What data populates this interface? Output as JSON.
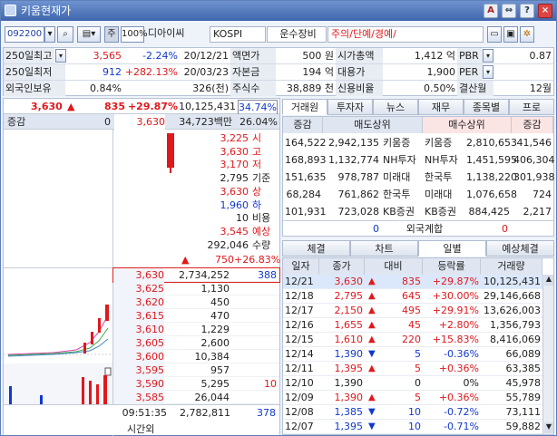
{
  "window": {
    "title": "키움현재가"
  },
  "toolbar": {
    "code": "092200",
    "name": "디아이씨",
    "market": "KOSPI",
    "sector": "운수장비",
    "warn": "주의/단예/경예/",
    "unit_label": "주",
    "pct_label": "100%"
  },
  "info": {
    "rows": [
      {
        "l1": "250일최고",
        "v1": "3,565",
        "p1": "-2.24%",
        "d1": "20/12/21",
        "l2": "액면가",
        "v2": "500 원",
        "l3": "시가총액",
        "v3": "1,412 억",
        "l4": "PBR",
        "v4": "0.87"
      },
      {
        "l1": "250일최저",
        "v1": "912",
        "p1": "+282.13%",
        "d1": "20/03/23",
        "l2": "자본금",
        "v2": "194 억",
        "l3": "대용가",
        "v3": "1,900",
        "l4": "PER",
        "v4": ""
      },
      {
        "l1": "외국인보유",
        "v1": "0.84%",
        "p1": "",
        "d1": "326(천)",
        "l2": "주식수",
        "v2": "38,889 천",
        "l3": "신용비율",
        "v3": "0.50%",
        "l4": "결산월",
        "v4": "12월"
      }
    ]
  },
  "quote": {
    "price": "3,630",
    "change": "835",
    "rate": "+29.87%",
    "volume": "10,125,431",
    "vol_rate": "34.74%",
    "zg_label": "증감",
    "zg_val": "0",
    "row2_price": "3,630",
    "row2_amt": "34,723백만",
    "row2_rate": "26.04%"
  },
  "summary": [
    {
      "v": "3,225",
      "k": "시",
      "c": "red"
    },
    {
      "v": "3,630",
      "k": "고",
      "c": "red"
    },
    {
      "v": "3,170",
      "k": "저",
      "c": "red"
    },
    {
      "v": "2,795",
      "k": "기준",
      "c": ""
    },
    {
      "v": "3,630",
      "k": "상",
      "c": "red"
    },
    {
      "v": "1,960",
      "k": "하",
      "c": "blue"
    },
    {
      "v": "10",
      "k": "비용",
      "c": ""
    },
    {
      "v": "3,545",
      "k": "예상",
      "c": "red"
    },
    {
      "v": "292,046",
      "k": "수량",
      "c": ""
    }
  ],
  "expected": {
    "chg": "750",
    "rate": "+26.83%"
  },
  "bids": [
    {
      "price": "3,630",
      "qty": "2,734,252",
      "extra": "388"
    },
    {
      "price": "3,625",
      "qty": "1,130",
      "extra": ""
    },
    {
      "price": "3,620",
      "qty": "450",
      "extra": ""
    },
    {
      "price": "3,615",
      "qty": "470",
      "extra": ""
    },
    {
      "price": "3,610",
      "qty": "1,229",
      "extra": ""
    },
    {
      "price": "3,605",
      "qty": "2,600",
      "extra": ""
    },
    {
      "price": "3,600",
      "qty": "10,384",
      "extra": ""
    },
    {
      "price": "3,595",
      "qty": "957",
      "extra": ""
    },
    {
      "price": "3,590",
      "qty": "5,295",
      "extra": "10"
    },
    {
      "price": "3,585",
      "qty": "26,044",
      "extra": ""
    }
  ],
  "bottom": {
    "time": "09:51:35",
    "total": "2,782,811",
    "extra": "378",
    "afterhours": "시간외"
  },
  "rtabs": [
    "거래원",
    "투자자",
    "뉴스",
    "재무",
    "종목별",
    "프로"
  ],
  "broker": {
    "headers": [
      "증감",
      "매도상위",
      "매수상위",
      "증감"
    ],
    "rows": [
      [
        "164,522",
        "2,942,135",
        "키움증",
        "키움증",
        "2,810,653",
        "41,546"
      ],
      [
        "168,893",
        "1,132,774",
        "NH투자",
        "NH투자",
        "1,451,595",
        "406,304"
      ],
      [
        "151,635",
        "978,787",
        "미래대",
        "한국투",
        "1,138,220",
        "301,938"
      ],
      [
        "68,284",
        "761,862",
        "한국투",
        "미래대",
        "1,076,658",
        "724"
      ],
      [
        "101,931",
        "723,028",
        "KB증권",
        "KB증권",
        "884,425",
        "2,217"
      ]
    ],
    "foreign_label": "외국계합",
    "foreign_sell": "0",
    "foreign_buy": "0"
  },
  "ctabs": [
    "체결",
    "차트",
    "일별",
    "예상체결"
  ],
  "daily": {
    "headers": [
      "일자",
      "종가",
      "대비",
      "등락률",
      "거래량"
    ],
    "rows": [
      [
        "12/21",
        "3,630",
        "up",
        "835",
        "+29.87%",
        "10,125,431"
      ],
      [
        "12/18",
        "2,795",
        "up",
        "645",
        "+30.00%",
        "29,146,668"
      ],
      [
        "12/17",
        "2,150",
        "up",
        "495",
        "+29.91%",
        "13,626,003"
      ],
      [
        "12/16",
        "1,655",
        "up",
        "45",
        "+2.80%",
        "1,356,793"
      ],
      [
        "12/15",
        "1,610",
        "up",
        "220",
        "+15.83%",
        "8,416,069"
      ],
      [
        "12/14",
        "1,390",
        "dn",
        "5",
        "-0.36%",
        "66,089"
      ],
      [
        "12/11",
        "1,395",
        "up",
        "5",
        "+0.36%",
        "63,385"
      ],
      [
        "12/10",
        "1,390",
        "",
        "0",
        "0%",
        "45,978"
      ],
      [
        "12/09",
        "1,390",
        "up",
        "5",
        "+0.36%",
        "55,789"
      ],
      [
        "12/08",
        "1,385",
        "dn",
        "10",
        "-0.72%",
        "73,111"
      ],
      [
        "12/07",
        "1,395",
        "dn",
        "10",
        "-0.71%",
        "59,882"
      ]
    ]
  },
  "colors": {
    "up": "#e0181c",
    "down": "#1038d0",
    "header": "#dfe6f1"
  }
}
